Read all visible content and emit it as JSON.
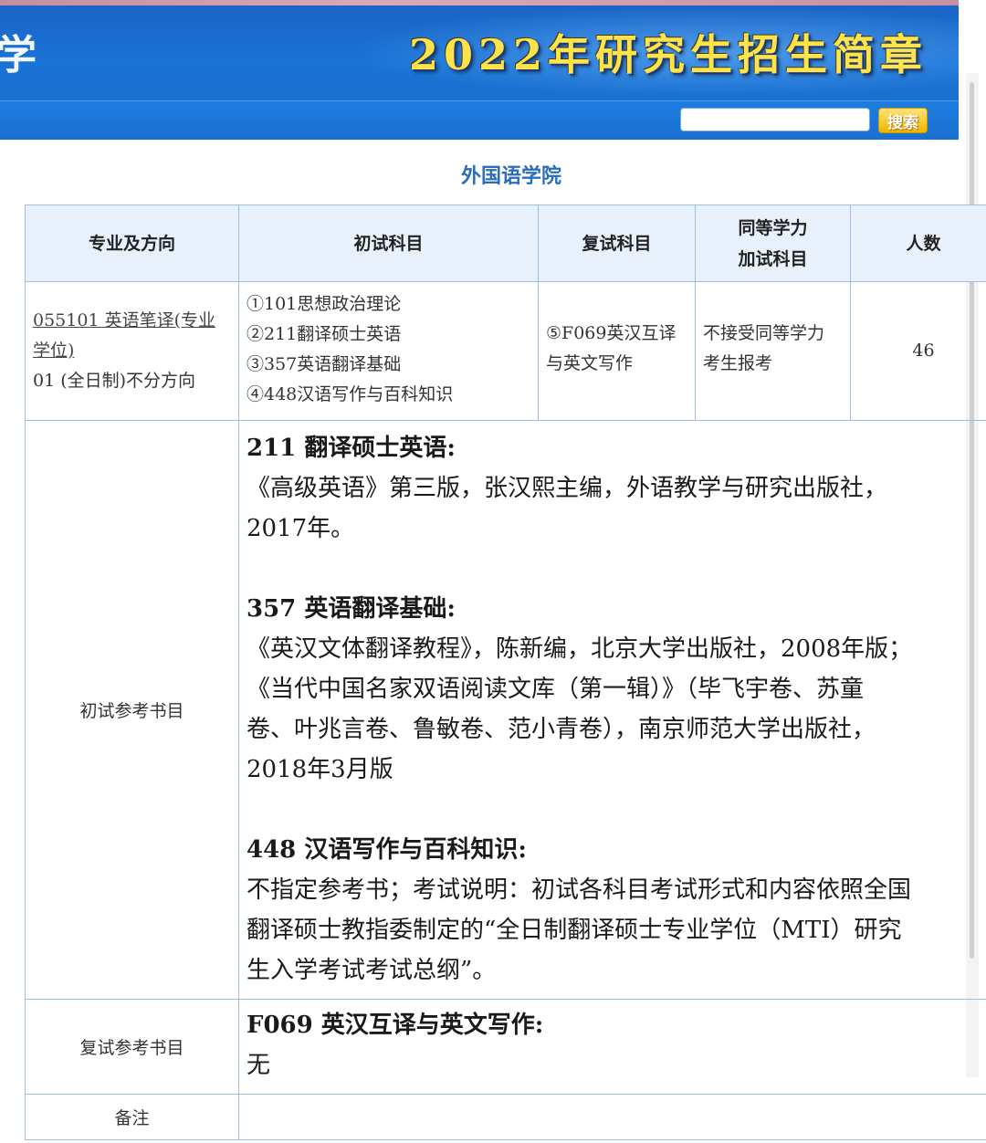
{
  "banner": {
    "left_glyph": "学",
    "title": "2022年研究生招生简章"
  },
  "search": {
    "placeholder": "",
    "button_label": "搜索"
  },
  "college": "外国语学院",
  "table": {
    "headers": {
      "major": "专业及方向",
      "initial_subjects": "初试科目",
      "retest_subjects": "复试科目",
      "equivalent_line1": "同等学力",
      "equivalent_line2": "加试科目",
      "count": "人数"
    },
    "row": {
      "major_link": "055101 英语笔译(专业学位)",
      "direction": "01 (全日制)不分方向",
      "initial_subjects": [
        "①101思想政治理论",
        "②211翻译硕士英语",
        "③357英语翻译基础",
        "④448汉语写作与百科知识"
      ],
      "retest_subject_line1": "⑤F069英汉互译",
      "retest_subject_line2": "与英文写作",
      "equivalent_line1": "不接受同等学力",
      "equivalent_line2": "考生报考",
      "count": "46"
    },
    "initial_refs_label": "初试参考书目",
    "initial_refs": {
      "ref1_title": "211 翻译硕士英语:",
      "ref1_line1": "《高级英语》第三版，张汉熙主编，外语教学与研究出版社，",
      "ref1_line2": "2017年。",
      "ref2_title": "357 英语翻译基础:",
      "ref2_line1": "《英汉文体翻译教程》，陈新编，北京大学出版社，2008年版；",
      "ref2_line2": "《当代中国名家双语阅读文库（第一辑）》（毕飞宇卷、苏童",
      "ref2_line3": "卷、叶兆言卷、鲁敏卷、范小青卷），南京师范大学出版社，",
      "ref2_line4": "2018年3月版",
      "ref3_title": "448 汉语写作与百科知识:",
      "ref3_line1": "不指定参考书；考试说明：初试各科目考试形式和内容依照全国",
      "ref3_line2": "翻译硕士教指委制定的“全日制翻译硕士专业学位（MTI）研究",
      "ref3_line3": "生入学考试考试总纲”。"
    },
    "retest_refs_label": "复试参考书目",
    "retest_refs": {
      "title": "F069 英汉互译与英文写作:",
      "body": "无"
    },
    "notes_label": "备注",
    "notes": ""
  },
  "colors": {
    "banner_blue": "#1a73d6",
    "title_yellow": "#ffe34a",
    "college_blue": "#2a6db8",
    "header_bg": "#e8f1fb",
    "border": "#9fbedf"
  }
}
